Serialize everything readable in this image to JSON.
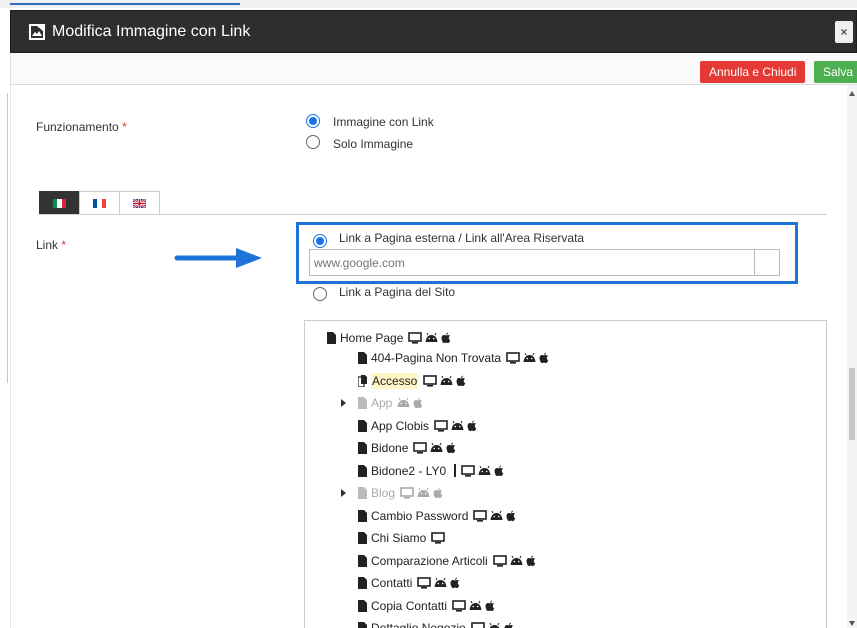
{
  "dialog": {
    "title": "Modifica Immagine con Link",
    "close_label": "×"
  },
  "toolbar": {
    "cancel_label": "Annulla e Chiudi",
    "save_label": "Salva"
  },
  "funzionamento": {
    "label": "Funzionamento",
    "required_mark": "*",
    "options": [
      {
        "label": "Immagine con Link",
        "checked": true
      },
      {
        "label": "Solo Immagine",
        "checked": false
      }
    ]
  },
  "language_tabs": [
    {
      "code": "it",
      "active": true
    },
    {
      "code": "fr",
      "active": false
    },
    {
      "code": "en",
      "active": false
    }
  ],
  "link": {
    "label": "Link",
    "required_mark": "*",
    "external_option_label": "Link a Pagina esterna / Link all'Area Riservata",
    "external_checked": true,
    "url_placeholder": "www.google.com",
    "site_option_label": "Link a Pagina del Sito",
    "site_checked": false
  },
  "tree": {
    "root": {
      "label": "Home Page",
      "devices": [
        "desktop-icon",
        "android-icon",
        "apple-icon"
      ]
    },
    "items": [
      {
        "label": "404-Pagina Non Trovata",
        "devices": [
          "desktop-icon",
          "android-icon",
          "apple-icon"
        ],
        "muted": false,
        "expandable": false
      },
      {
        "label": "Accesso",
        "devices": [
          "desktop-icon",
          "android-icon",
          "apple-icon"
        ],
        "muted": false,
        "expandable": false,
        "highlighted": true
      },
      {
        "label": "App",
        "devices": [
          "android-icon",
          "apple-icon"
        ],
        "muted": true,
        "expandable": true
      },
      {
        "label": "App Clobis",
        "devices": [
          "desktop-icon",
          "android-icon",
          "apple-icon"
        ],
        "muted": false,
        "expandable": false
      },
      {
        "label": "Bidone",
        "devices": [
          "desktop-icon",
          "android-icon",
          "apple-icon"
        ],
        "muted": false,
        "expandable": false
      },
      {
        "label": "Bidone2 - LY0",
        "devices": [
          "desktop-icon",
          "android-icon",
          "apple-icon"
        ],
        "muted": false,
        "expandable": false,
        "separator": true
      },
      {
        "label": "Blog",
        "devices": [
          "desktop-icon",
          "android-icon",
          "apple-icon"
        ],
        "muted": true,
        "expandable": true
      },
      {
        "label": "Cambio Password",
        "devices": [
          "desktop-icon",
          "android-icon",
          "apple-icon"
        ],
        "muted": false,
        "expandable": false
      },
      {
        "label": "Chi Siamo",
        "devices": [
          "desktop-icon"
        ],
        "muted": false,
        "expandable": false
      },
      {
        "label": "Comparazione Articoli",
        "devices": [
          "desktop-icon",
          "android-icon",
          "apple-icon"
        ],
        "muted": false,
        "expandable": false
      },
      {
        "label": "Contatti",
        "devices": [
          "desktop-icon",
          "android-icon",
          "apple-icon"
        ],
        "muted": false,
        "expandable": false
      },
      {
        "label": "Copia Contatti",
        "devices": [
          "desktop-icon",
          "android-icon",
          "apple-icon"
        ],
        "muted": false,
        "expandable": false
      },
      {
        "label": "Dettaglio Negozio",
        "devices": [
          "desktop-icon",
          "android-icon",
          "apple-icon"
        ],
        "muted": false,
        "expandable": false
      }
    ]
  },
  "colors": {
    "titlebar": "#2e2e2e",
    "cancel": "#e53935",
    "save": "#4caf50",
    "highlight_border": "#1e73d8",
    "arrow": "#1e73d8"
  }
}
